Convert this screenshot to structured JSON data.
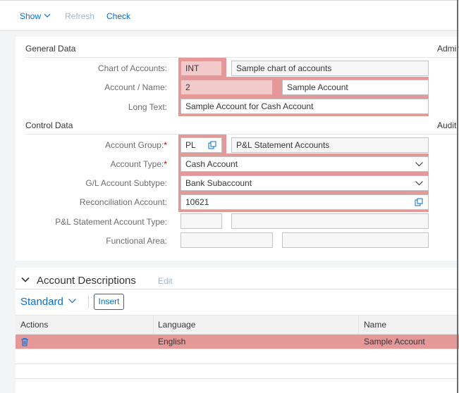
{
  "toolbar": {
    "show_label": "Show",
    "refresh_label": "Refresh",
    "check_label": "Check"
  },
  "sections": {
    "general": "General Data",
    "control": "Control Data",
    "admin_truncated": "Admir",
    "audit_truncated": "Audit"
  },
  "general": {
    "chart_label": "Chart of Accounts:",
    "chart_code": "INT",
    "chart_name": "Sample chart of accounts",
    "account_label": "Account / Name:",
    "account_number": "2",
    "account_name": "Sample Account",
    "longtext_label": "Long Text:",
    "longtext_value": "Sample Account for Cash Account"
  },
  "control": {
    "group_label": "Account Group:",
    "group_code": "PL",
    "group_name": "P&L Statement Accounts",
    "type_label": "Account Type:",
    "type_value": "Cash Account",
    "subtype_label": "G/L Account Subtype:",
    "subtype_value": "Bank Subaccount",
    "recon_label": "Reconciliation Account:",
    "recon_value": "10621",
    "pl_type_label": "P&L Statement Account Type:",
    "pl_type_value": "",
    "pl_type_desc": "",
    "func_area_label": "Functional Area:",
    "func_area_value": "",
    "func_area_desc": "",
    "required_mark": "*"
  },
  "descriptions": {
    "title": "Account Descriptions",
    "edit_label": "Edit",
    "variant": "Standard",
    "insert_label": "Insert",
    "columns": [
      "Actions",
      "Language",
      "Name"
    ],
    "rows": [
      {
        "language": "English",
        "name": "Sample Account"
      }
    ]
  },
  "colors": {
    "accent": "#0a6ed1",
    "error_highlight": "#e59898",
    "required": "#bb0000"
  },
  "icons": {
    "show": "chevron-down-icon",
    "value_help": "value-help-icon",
    "dropdown": "chevron-down-icon",
    "delete": "trash-icon",
    "collapse": "chevron-down-icon"
  }
}
